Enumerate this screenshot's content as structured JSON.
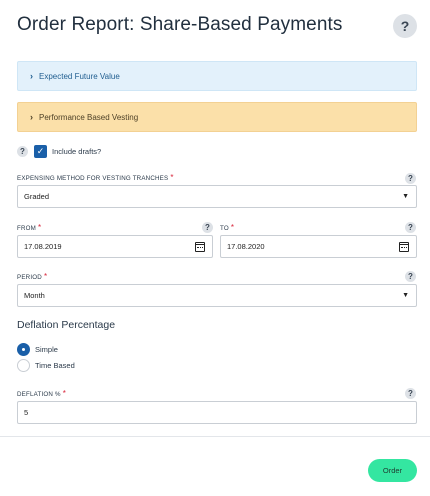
{
  "title": "Order Report: Share-Based Payments",
  "help_glyph": "?",
  "sections": {
    "expected_future_value": "Expected Future Value",
    "performance_based_vesting": "Performance Based Vesting",
    "chevron": "›"
  },
  "drafts": {
    "label": "Include drafts?",
    "checked": true,
    "check_glyph": "✓"
  },
  "expensing_method": {
    "label": "EXPENSING METHOD FOR VESTING TRANCHES",
    "required_mark": "*",
    "value": "Graded",
    "caret": "▼"
  },
  "from": {
    "label": "FROM",
    "required_mark": "*",
    "value": "17.08.2019"
  },
  "to": {
    "label": "TO",
    "required_mark": "*",
    "value": "17.08.2020"
  },
  "period": {
    "label": "PERIOD",
    "required_mark": "*",
    "value": "Month",
    "caret": "▼"
  },
  "deflation": {
    "heading": "Deflation Percentage",
    "options": [
      {
        "label": "Simple",
        "selected": true
      },
      {
        "label": "Time Based",
        "selected": false
      }
    ]
  },
  "deflation_pct": {
    "label": "DEFLATION %",
    "required_mark": "*",
    "value": "5"
  },
  "order_button": "Order",
  "colors": {
    "accent_blue": "#1a5fa8",
    "info_bg": "#e3f1fb",
    "warning_bg": "#fbe0a9",
    "order_button": "#34e6a1",
    "required": "#d9253a"
  }
}
